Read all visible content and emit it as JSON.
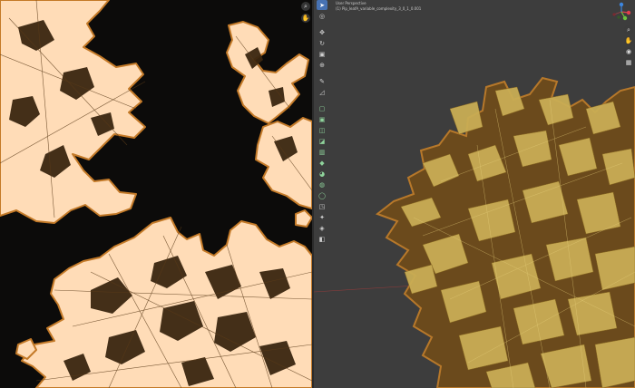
{
  "viewport": {
    "view_name": "User Perspective",
    "object_name": "(1) Pip_leafA_variable_complexity_3_0_1_0.001"
  },
  "uv_nav_icons": [
    "zoom-icon",
    "hand-icon"
  ],
  "viewport_nav_icons": [
    "zoom-icon",
    "hand-icon",
    "camera-icon",
    "grid-icon"
  ],
  "tools": [
    {
      "name": "select-tool-icon",
      "glyph": "➤",
      "active": true
    },
    {
      "name": "cursor-tool-icon",
      "glyph": "◎"
    },
    {
      "sep": true
    },
    {
      "name": "move-tool-icon",
      "glyph": "✥"
    },
    {
      "name": "rotate-tool-icon",
      "glyph": "↻"
    },
    {
      "name": "scale-tool-icon",
      "glyph": "▣"
    },
    {
      "name": "transform-tool-icon",
      "glyph": "⊕"
    },
    {
      "sep": true
    },
    {
      "name": "annotate-tool-icon",
      "glyph": "✎"
    },
    {
      "name": "measure-tool-icon",
      "glyph": "◿"
    },
    {
      "sep": true
    },
    {
      "name": "add-cube-tool-icon",
      "glyph": "▢",
      "green": true
    },
    {
      "name": "extrude-tool-icon",
      "glyph": "▣",
      "green": true
    },
    {
      "name": "inset-tool-icon",
      "glyph": "◫",
      "green": true
    },
    {
      "name": "bevel-tool-icon",
      "glyph": "◪",
      "green": true
    },
    {
      "name": "loop-cut-tool-icon",
      "glyph": "▥",
      "green": true
    },
    {
      "name": "knife-tool-icon",
      "glyph": "◆",
      "green": true
    },
    {
      "name": "poly-build-tool-icon",
      "glyph": "◕",
      "green": true
    },
    {
      "name": "spin-tool-icon",
      "glyph": "◍",
      "green": true
    },
    {
      "name": "smooth-tool-icon",
      "glyph": "◯",
      "green": true
    },
    {
      "name": "edge-slide-tool-icon",
      "glyph": "◳"
    },
    {
      "name": "shrink-tool-icon",
      "glyph": "✦"
    },
    {
      "name": "shear-tool-icon",
      "glyph": "◈"
    },
    {
      "name": "rip-tool-icon",
      "glyph": "◧"
    }
  ],
  "colors": {
    "uv_bg": "#0c0b0a",
    "uv_face": "#ffdcb7",
    "uv_edge": "#c47a28",
    "uv_inner": "#3a2610",
    "viewport_bg": "#3d3d3d",
    "leaf": "#c9ad55",
    "leaf_shadow": "#6b4a1c",
    "active_tool": "#4772b3"
  }
}
